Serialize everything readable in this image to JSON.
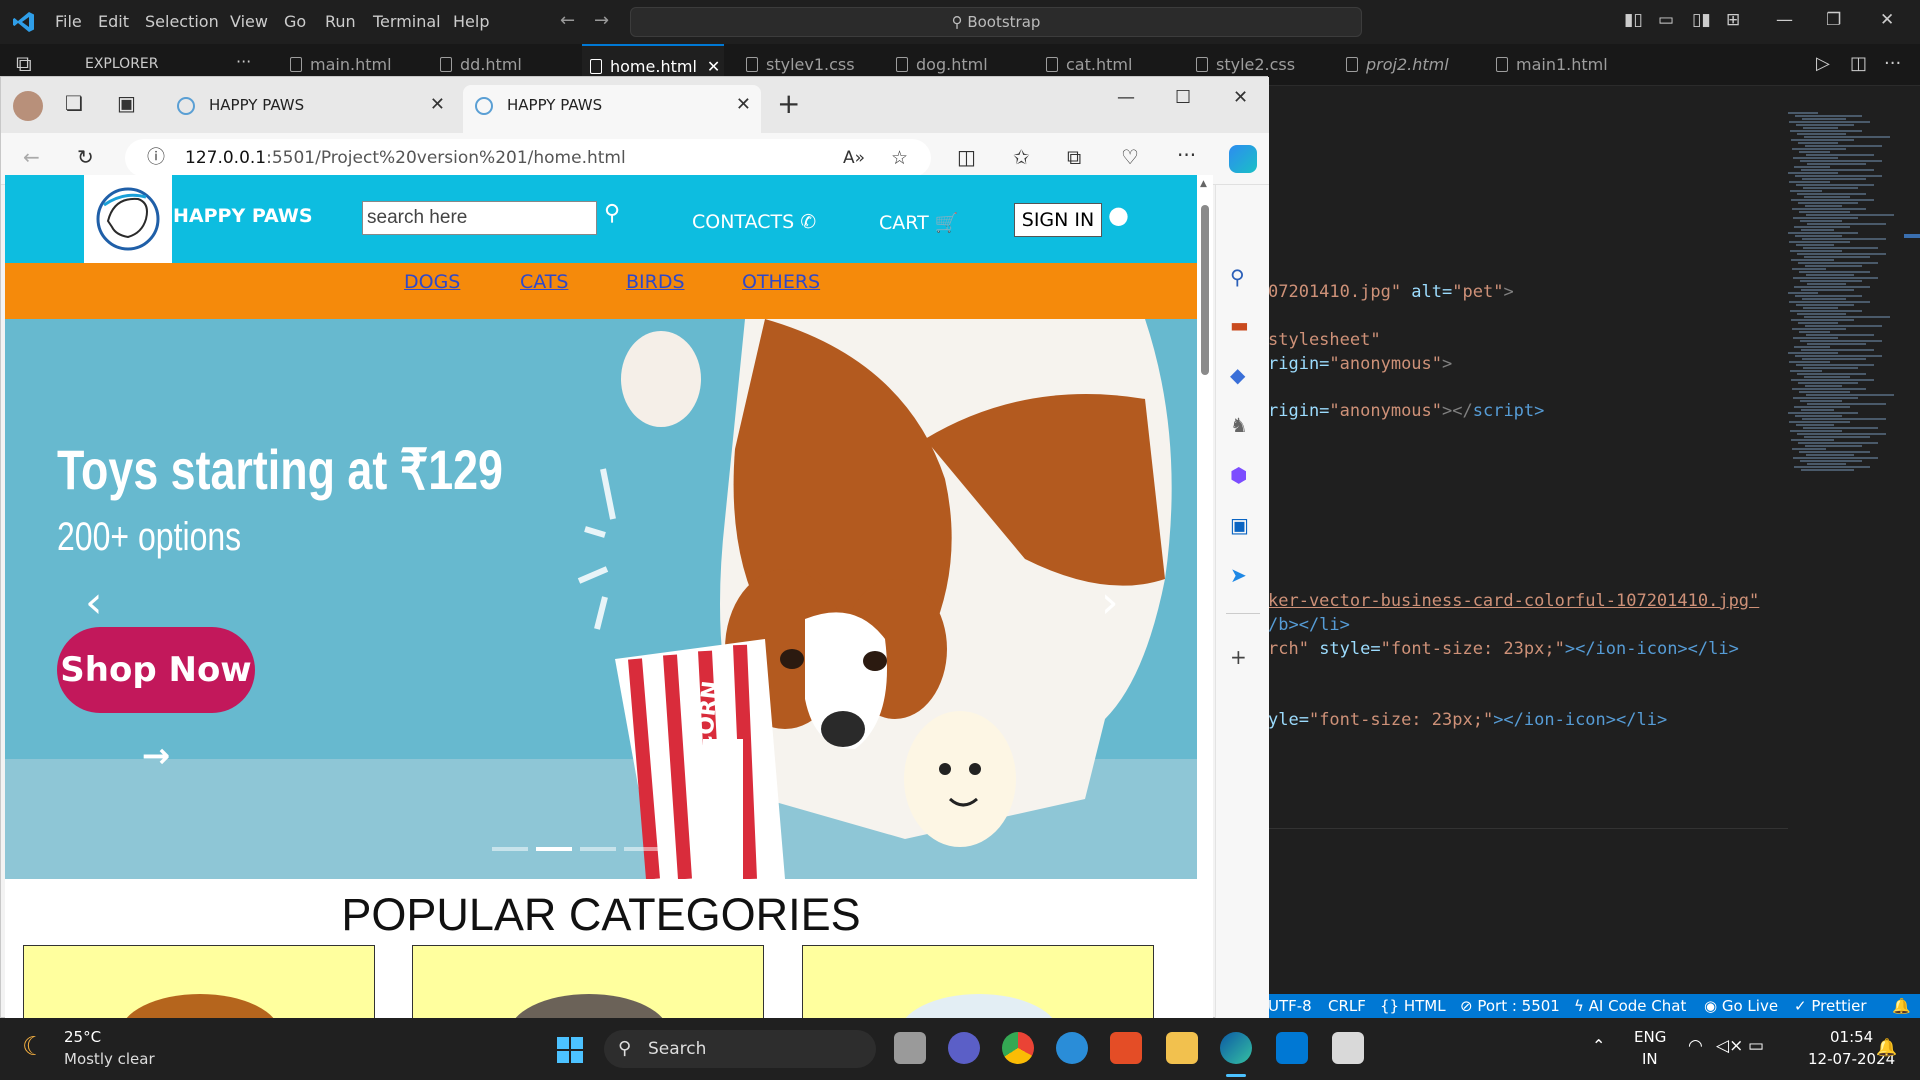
{
  "vscode": {
    "menu": [
      "File",
      "Edit",
      "Selection",
      "View",
      "Go",
      "Run",
      "Terminal",
      "Help"
    ],
    "search_text": "Bootstrap",
    "explorer_label": "EXPLORER",
    "tabs": [
      {
        "label": "main.html"
      },
      {
        "label": "dd.html"
      },
      {
        "label": "home.html",
        "close": "✕"
      },
      {
        "label": "stylev1.css"
      },
      {
        "label": "dog.html"
      },
      {
        "label": "cat.html"
      },
      {
        "label": "style2.css"
      },
      {
        "label": "proj2.html"
      },
      {
        "label": "main1.html"
      }
    ],
    "code_lines": [
      {
        "a": "07201410.jpg\"",
        "b": " alt=",
        "c": "\"pet\"",
        "d": ">"
      },
      {
        "a": "stylesheet\"",
        "b": "",
        "c": "",
        "d": ""
      },
      {
        "a": "rigin=",
        "b": "\"anonymous\"",
        "c": ">",
        "d": ""
      },
      {
        "a": "rigin=",
        "b": "\"anonymous\"",
        "c": "></",
        "d": "script>"
      },
      {
        "a": "ker-vector-business-card-colorful-107201410.jpg\"",
        "b": "",
        "c": "",
        "d": ""
      },
      {
        "a": "/b></li>",
        "b": "",
        "c": "",
        "d": ""
      },
      {
        "a": "rch\"",
        "b": " style=",
        "c": "\"font-size: 23px;\"",
        "d": "></ion-icon></li>"
      },
      {
        "a": "yle=",
        "b": "\"font-size: 23px;\"",
        "c": "></ion-icon></li>",
        "d": ""
      }
    ],
    "status": {
      "encoding": "UTF-8",
      "eol": "CRLF",
      "language": "HTML",
      "port": "Port : 5501",
      "ai": "AI Code Chat",
      "golive": "Go Live",
      "prettier": "Prettier"
    }
  },
  "browser": {
    "tabs": [
      {
        "title": "HAPPY PAWS",
        "close": "✕"
      },
      {
        "title": "HAPPY PAWS",
        "close": "✕"
      }
    ],
    "new_tab": "+",
    "url_host": "127.0.0.1",
    "url_path": ":5501/Project%20version%201/home.html"
  },
  "site": {
    "brand": "HAPPY PAWS",
    "search_placeholder": "search here",
    "contacts": "CONTACTS",
    "cart": "CART",
    "signin": "SIGN IN",
    "nav": [
      "DOGS",
      "CATS",
      "BIRDS",
      "OTHERS"
    ],
    "hero_title": "Toys starting at ₹129",
    "hero_subtitle": "200+ options",
    "hero_button": "Shop Now →",
    "hero_product_label": "POPCORN",
    "carousel_active_index": 1,
    "popular_title": "POPULAR CATEGORIES"
  },
  "taskbar": {
    "temp": "25°C",
    "weather": "Mostly clear",
    "search": "Search",
    "lang1": "ENG",
    "lang2": "IN",
    "time": "01:54",
    "date": "12-07-2024"
  },
  "colors": {
    "site_header": "#0dbde0",
    "site_nav": "#f58a0b",
    "hero_bg": "#67b9cf",
    "shop_button": "#c2185b",
    "vscode_status": "#0078d4",
    "category_card": "#ffff9e"
  }
}
